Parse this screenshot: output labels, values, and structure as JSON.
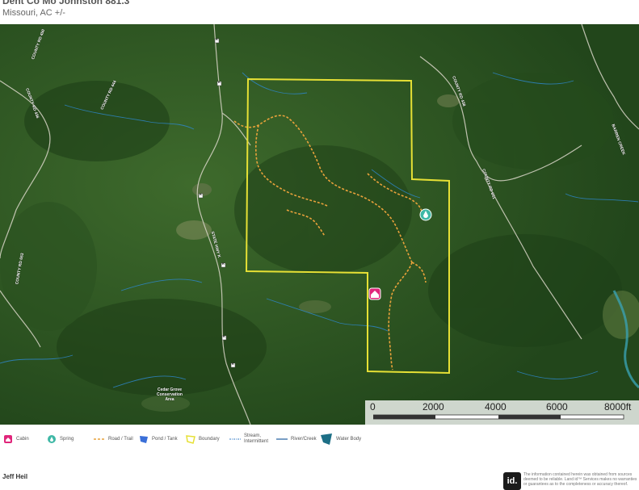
{
  "header": {
    "title": "Dent Co Mo Johnston 881.3",
    "subtitle": "Missouri,  AC +/-"
  },
  "map": {
    "road_labels": [
      "COUNTY RD 450",
      "COUNTY RD 444",
      "COUNTY RD 436",
      "COUNTY RD 438",
      "COUNTY RD 651",
      "COUNTY RD 653",
      "STATE HWY K",
      "BARREN CREEK"
    ],
    "poi_labels": [
      "Cedar Grove Conservation Area"
    ],
    "highway_shields": [
      "K",
      "K",
      "K",
      "K",
      "K",
      "K"
    ]
  },
  "scale_bar": {
    "ticks": [
      "0",
      "2000",
      "4000",
      "6000",
      "8000ft"
    ]
  },
  "legend": {
    "items": [
      {
        "label": "Cabin",
        "icon": "cabin-icon",
        "color": "#e0267b"
      },
      {
        "label": "Spring",
        "icon": "spring-icon",
        "color": "#3fb8a6"
      },
      {
        "label": "Road / Trail",
        "icon": "road-trail-icon",
        "color": "#e9a23b"
      },
      {
        "label": "Pond / Tank",
        "icon": "pond-icon",
        "color": "#3a6fd8"
      },
      {
        "label": "Boundary",
        "icon": "boundary-icon",
        "color": "#e6e035"
      },
      {
        "label": "Stream, Intermittent",
        "icon": "stream-icon",
        "color": "#3a7fc8"
      },
      {
        "label": "River/Creek",
        "icon": "river-icon",
        "color": "#1f5e9e"
      },
      {
        "label": "Water Body",
        "icon": "water-body-icon",
        "color": "#1d6f86"
      }
    ]
  },
  "footer": {
    "agent_name": "Jeff Heil",
    "logo_text": "id.",
    "disclaimer": "The information contained herein was obtained from sources deemed to be reliable. Land id™ Services makes no warranties or guarantees as to the completeness or accuracy thereof."
  }
}
